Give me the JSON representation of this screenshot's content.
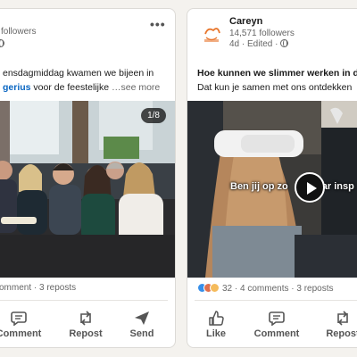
{
  "left_post": {
    "followers": "followers",
    "text_line1": "ensdagmiddag kwamen we bijeen in",
    "text_link": "gerius",
    "text_line2_rest": " voor de feestelijke",
    "see_more": "…see more",
    "image_counter": "1/8",
    "social": "omment · 3 reposts",
    "actions": {
      "comment": "Comment",
      "repost": "Repost",
      "send": "Send"
    }
  },
  "right_post": {
    "author": "Careyn",
    "followers": "14,571 followers",
    "meta": "4d · Edited · ",
    "text_line1": "Hoe kunnen we slimmer werken in de ouc",
    "text_line2": "Dat kun je samen met ons ontdekken",
    "video_caption": "Ben jij op zo",
    "video_caption_tail": "ar insp",
    "reaction_count": "32",
    "social_rest": " · 4 comments · 3 reposts",
    "actions": {
      "like": "Like",
      "comment": "Comment",
      "repost": "Repost"
    }
  },
  "colors": {
    "link": "#0a66c2",
    "brand": "#e8772e"
  }
}
